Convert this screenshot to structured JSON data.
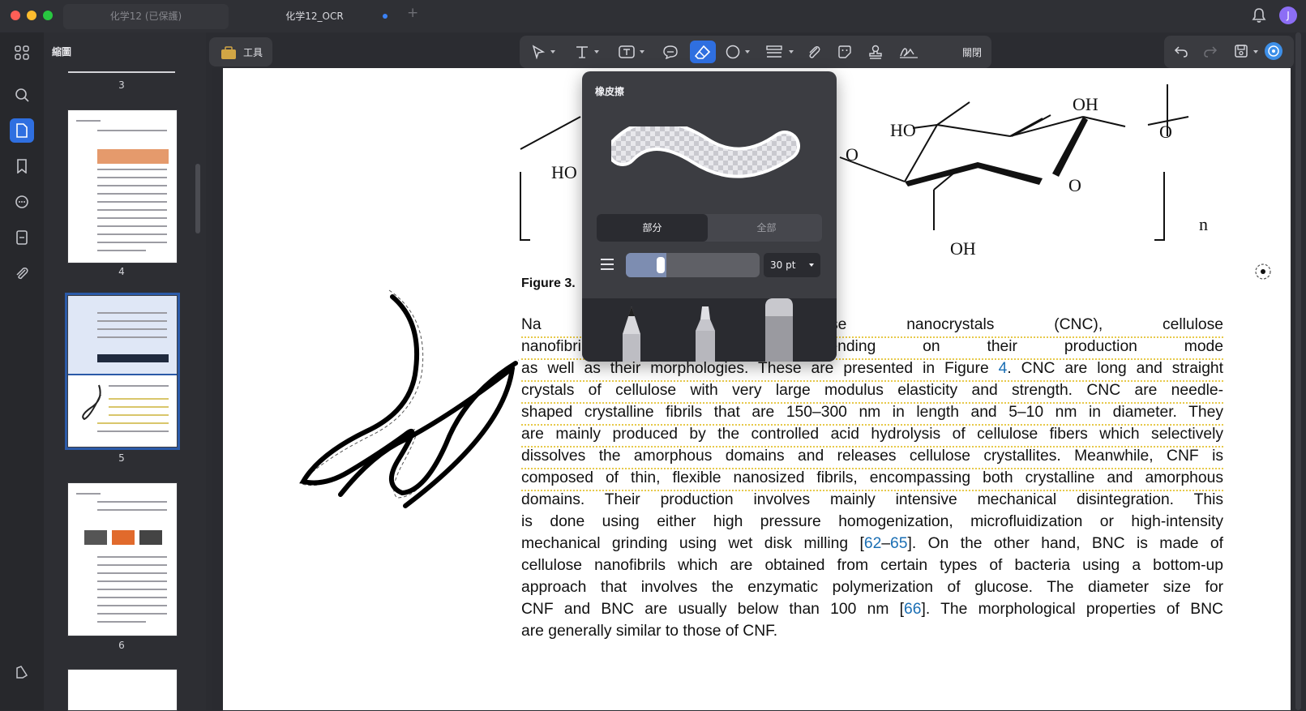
{
  "window": {
    "tabs": [
      {
        "label": "化学12 (已保護)",
        "active": false
      },
      {
        "label": "化学12_OCR",
        "active": true
      }
    ],
    "avatar_initial": "J"
  },
  "sidebar": {
    "title": "縮圖",
    "pages": [
      {
        "number": "3",
        "selected": false
      },
      {
        "number": "4",
        "selected": false
      },
      {
        "number": "5",
        "selected": true
      },
      {
        "number": "6",
        "selected": false
      }
    ]
  },
  "toolbar": {
    "tools_label": "工具",
    "close_label": "關閉"
  },
  "eraser_panel": {
    "title": "橡皮擦",
    "segments": [
      "部分",
      "全部"
    ],
    "active_segment": "部分",
    "size_value": "30 pt",
    "size_fraction": 0.3
  },
  "document": {
    "figure_label": "Figure 3.",
    "chem_labels": [
      "HO",
      "OH",
      "HO",
      "O",
      "O",
      "O",
      "OH",
      "n"
    ],
    "lines": [
      {
        "text": "Na                                               iously into cellulose nanocrystals (CNC), cellulose"
      },
      {
        "text": "nanofibri                                         ulose (BNC) depending on their production mode"
      },
      {
        "text": "as well as their morphologies. These are presented in Figure ",
        "link": "4",
        "after": ". CNC are long and straight"
      },
      {
        "text": "crystals of cellulose with very large modulus elasticity and strength. CNC are needle-"
      },
      {
        "text": "shaped crystalline fibrils that are 150–300 nm in length and 5–10 nm in diameter. They"
      },
      {
        "text": "are mainly produced by the controlled acid hydrolysis of cellulose fibers which selectively"
      },
      {
        "text": "dissolves the amorphous domains and releases cellulose crystallites. Meanwhile, CNF is"
      },
      {
        "text": "composed of thin, flexible nanosized fibrils, encompassing both crystalline and amorphous"
      },
      {
        "text": "domains. Their production involves mainly intensive mechanical disintegration. This"
      },
      {
        "text": "is done using either high pressure homogenization, microfluidization or high-intensity"
      },
      {
        "text": "mechanical grinding using wet disk milling [",
        "link": "62",
        "mid": "–",
        "link2": "65",
        "after": "]. On the other hand, BNC is made of"
      },
      {
        "text": "cellulose nanofibrils which are obtained from certain types of bacteria using a bottom-up"
      },
      {
        "text": "approach that involves the enzymatic polymerization of glucose. The diameter size for"
      },
      {
        "text": "CNF and BNC are usually below than 100 nm [",
        "link": "66",
        "after": "]. The morphological properties of BNC"
      },
      {
        "text": "are generally similar to those of CNF."
      }
    ]
  },
  "colors": {
    "accent": "#2f6fe0",
    "highlight_underline": "#e7c94a",
    "link": "#1b6fb4"
  }
}
